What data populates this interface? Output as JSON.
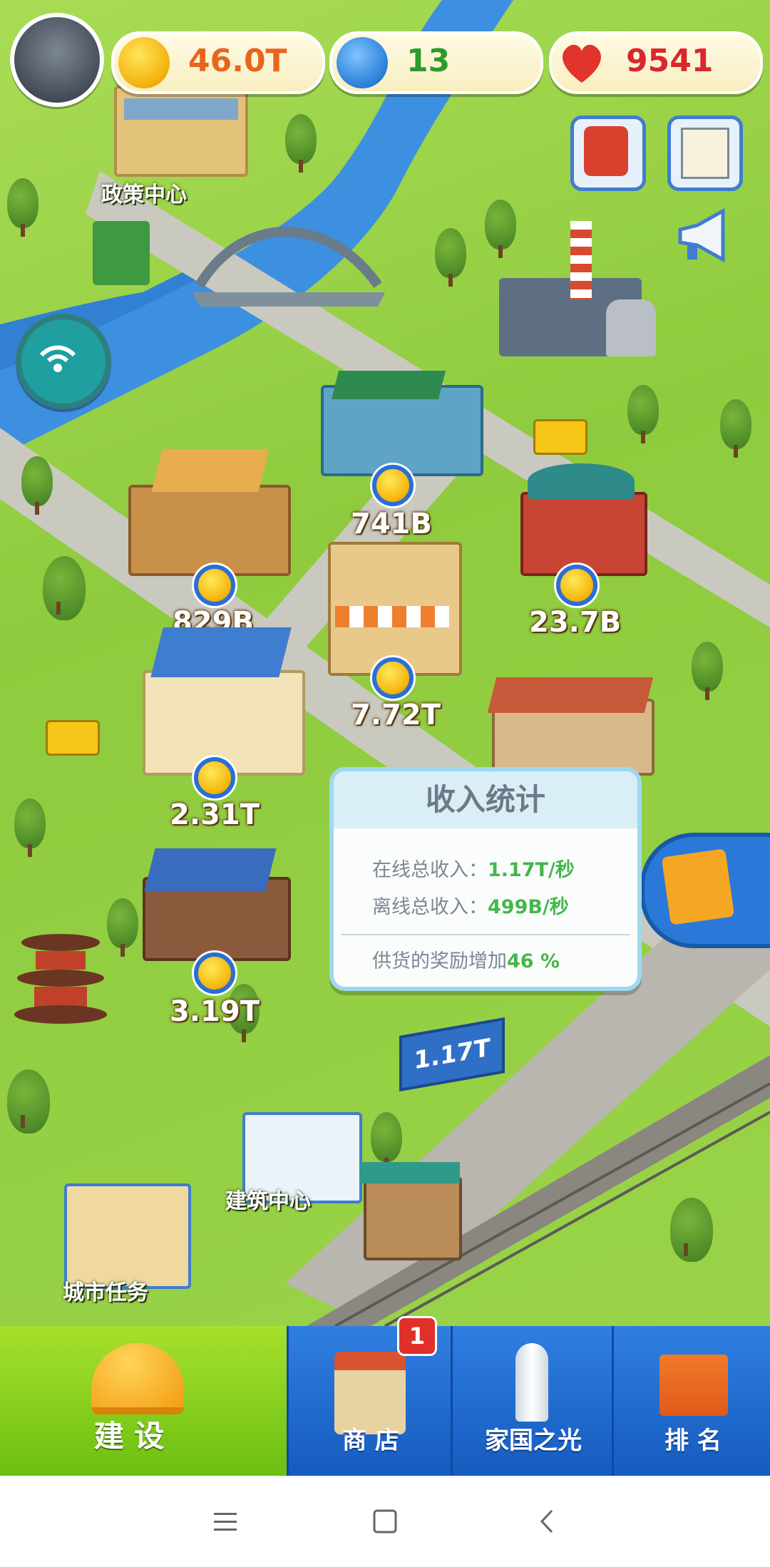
{
  "top_bar": {
    "coins": "46.0T",
    "stars": "13",
    "hearts": "9541",
    "colors": {
      "coins": "#e8661c",
      "stars": "#2f9a2c",
      "hearts": "#d9272b"
    }
  },
  "map_labels": {
    "policy_center": "政策中心",
    "building_center": "建筑中心",
    "city_tasks": "城市任务"
  },
  "incomes": [
    "741B",
    "829B",
    "23.7B",
    "7.72T",
    "2.31T",
    "3.19T"
  ],
  "billboard": "1.17T",
  "popup": {
    "title": "收入统计",
    "online_label": "在线总收入：",
    "online_value": "1.17T/秒",
    "offline_label": "离线总收入：",
    "offline_value": "499B/秒",
    "bonus_label": "供货的奖励增加",
    "bonus_value": "46 %"
  },
  "nav": {
    "build": "建 设",
    "shop": "商 店",
    "shop_badge": "1",
    "homeland": "家国之光",
    "rank": "排 名"
  },
  "icons": [
    "avatar",
    "coin-icon",
    "star-icon",
    "heart-icon",
    "rescue-icon",
    "notes-icon",
    "megaphone-icon",
    "wifi-icon",
    "blueprint-icon"
  ]
}
